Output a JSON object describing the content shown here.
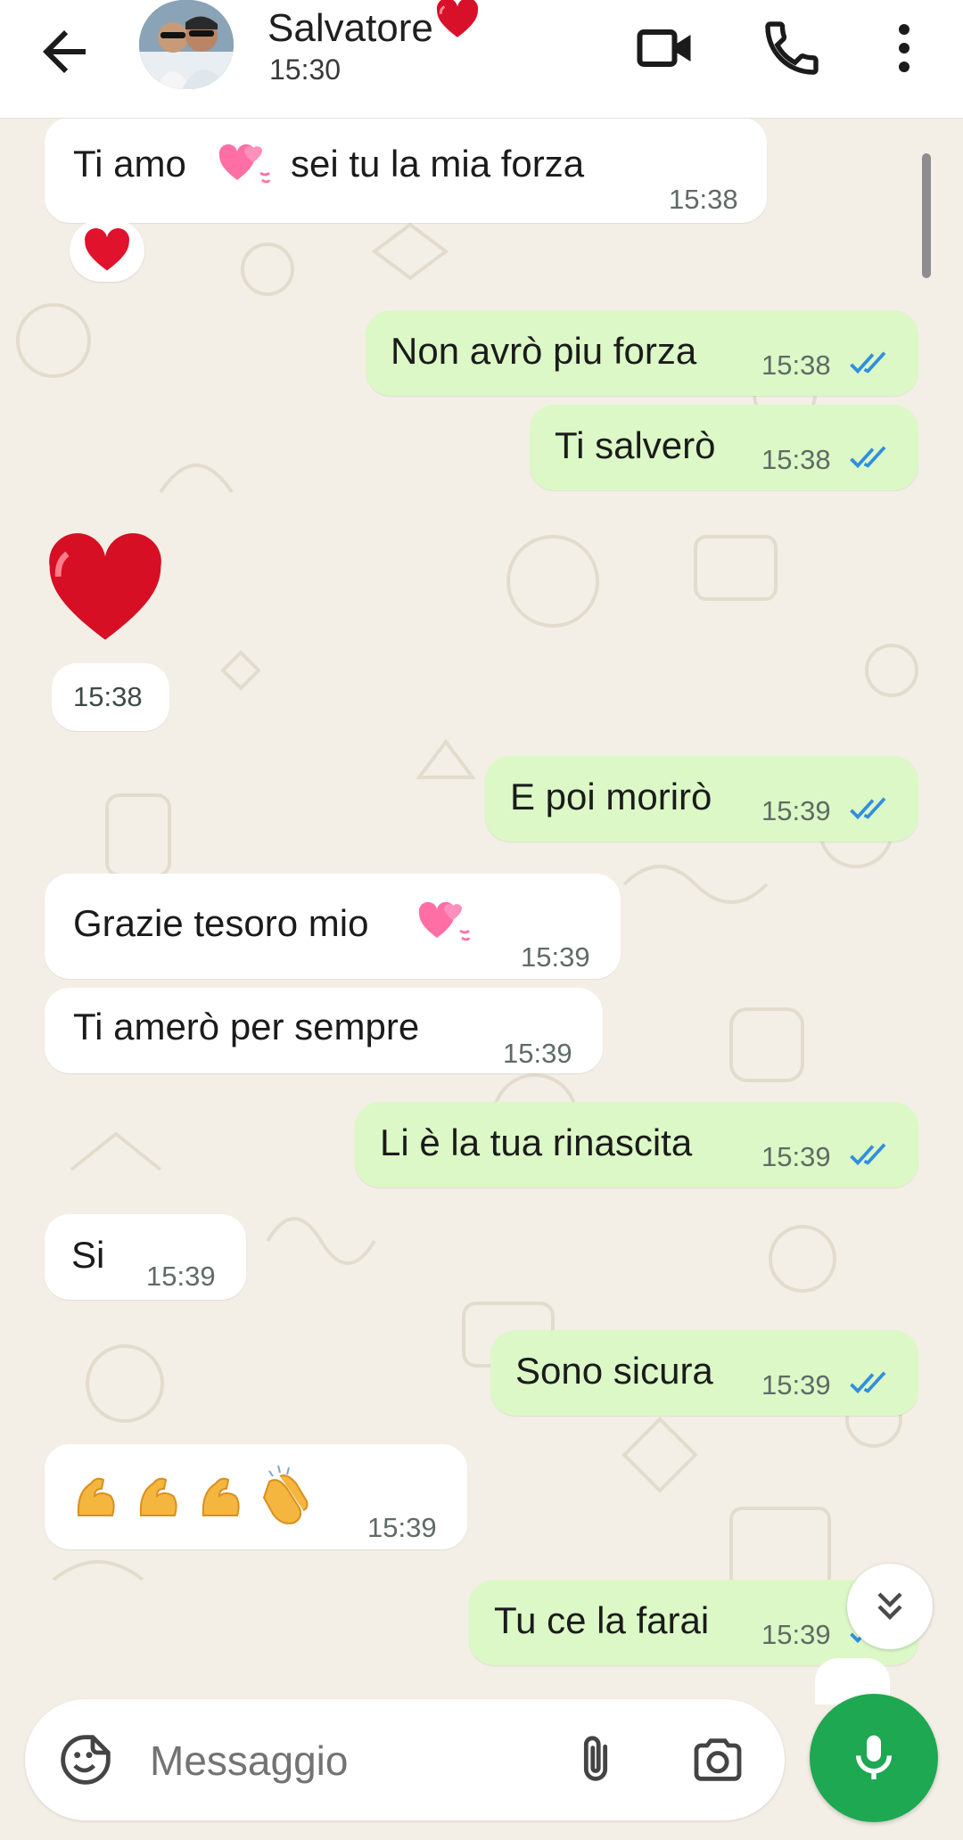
{
  "header": {
    "contact_name": "Salvatore",
    "name_emoji": "heart-emoji",
    "status": "15:30",
    "icons": [
      "back-arrow-icon",
      "video-call-icon",
      "phone-icon",
      "more-vertical-icon"
    ]
  },
  "messages": [
    {
      "side": "in",
      "text": "Ti amo",
      "text2": "sei tu la mia forza",
      "time": "15:38",
      "emoji": "two-hearts-emoji",
      "reaction": "heart-emoji"
    },
    {
      "side": "out",
      "text": "Non avrò piu forza",
      "time": "15:38",
      "ticks": "read"
    },
    {
      "side": "out",
      "text": "Ti salverò",
      "time": "15:38",
      "ticks": "read"
    },
    {
      "side": "in",
      "text": "",
      "time": "15:38",
      "emoji": "big-heart-emoji"
    },
    {
      "side": "out",
      "text": "E poi morirò",
      "time": "15:39",
      "ticks": "read"
    },
    {
      "side": "in",
      "text": "Grazie tesoro mio",
      "time": "15:39",
      "emoji": "two-hearts-emoji"
    },
    {
      "side": "in",
      "text": "Ti amerò per sempre",
      "time": "15:39"
    },
    {
      "side": "out",
      "text": "Li è la tua rinascita",
      "time": "15:39",
      "ticks": "read"
    },
    {
      "side": "in",
      "text": "Si",
      "time": "15:39"
    },
    {
      "side": "out",
      "text": "Sono sicura",
      "time": "15:39",
      "ticks": "read"
    },
    {
      "side": "in",
      "text": "",
      "time": "15:39",
      "emoji": "flexed-biceps-x3-clapping-hands-emoji"
    },
    {
      "side": "out",
      "text": "Tu ce la farai",
      "time": "15:39",
      "ticks": "read"
    }
  ],
  "composer": {
    "placeholder": "Messaggio",
    "icons": [
      "sticker-icon",
      "attach-icon",
      "camera-icon",
      "mic-icon"
    ]
  },
  "colors": {
    "outgoing": "#dcf8c6",
    "incoming": "#ffffff",
    "wallpaper": "#f3efe6",
    "mic": "#1da851",
    "read_ticks": "#2f8fe0"
  }
}
